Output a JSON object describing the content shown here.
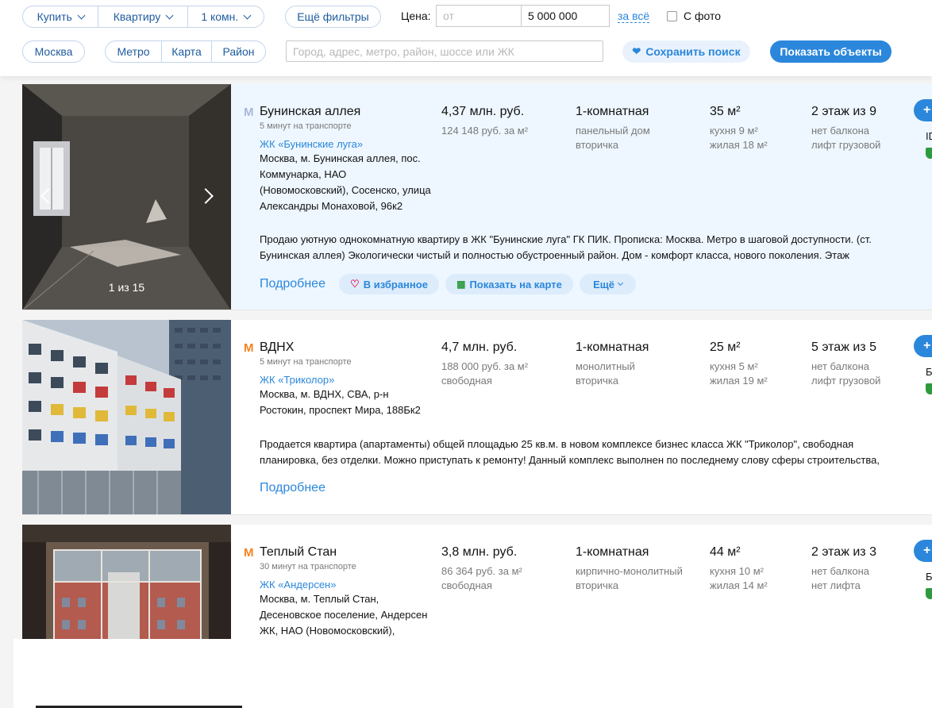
{
  "filters": {
    "deal": "Купить",
    "type": "Квартиру",
    "rooms": "1 комн.",
    "more_filters": "Ещё фильтры",
    "price_label": "Цена:",
    "price_from_placeholder": "от",
    "price_to": "5 000 000",
    "price_unit": "за всё",
    "photo_label": "С фото",
    "city": "Москва",
    "metro": "Метро",
    "map": "Карта",
    "district": "Район",
    "search_placeholder": "Город, адрес, метро, район, шоссе или ЖК",
    "save_search": "Сохранить поиск",
    "show_objects": "Показать объекты"
  },
  "colors": {
    "accent": "#2b87db",
    "metro_line_1": "#a8b8d8",
    "metro_line_orange": "#f58220",
    "highlight_bg": "#eef7ff"
  },
  "listings": [
    {
      "station": "Бунинская аллея",
      "metro_icon": "metro-m-icon",
      "transport": "5 минут на транспорте",
      "complex": "ЖК «Бунинские луга»",
      "address": [
        "Москва, м. Бунинская аллея, пос.",
        "Коммунарка, НАО",
        "(Новомосковский), Сосенско, улица",
        "Александры Монаховой, 96к2"
      ],
      "price": "4,37 млн. руб.",
      "price_per_m": "124 148 руб. за м²",
      "price_note": "",
      "rooms": "1-комнатная",
      "building": "панельный дом",
      "market": "вторичка",
      "area": "35 м²",
      "kitchen": "кухня 9 м²",
      "living": "жилая 18 м²",
      "floor": "2 этаж из 9",
      "balcony": "нет балкона",
      "lift": "лифт грузовой",
      "desc": [
        "Продаю уютную однокомнатную квартиру в ЖК \"Бунинские луга\" ГК ПИК. Прописка: Москва. Метро в шаговой доступности. (ст.",
        "Бунинская аллея) Экологически чистый и полностью обустроенный район. Дом - комфорт класса, нового поколения. Этаж"
      ],
      "photo_counter": "1 из 15",
      "more": "Подробнее",
      "favorite": "В избранное",
      "show_map": "Показать на карте",
      "extra": "Ещё",
      "right_code": "ID"
    },
    {
      "station": "ВДНХ",
      "metro_icon": "metro-m-icon",
      "transport": "5 минут на транспорте",
      "complex": "ЖК «Триколор»",
      "address": [
        "Москва, м. ВДНХ, СВА, р-н",
        "Ростокин, проспект Мира, 188Бк2"
      ],
      "price": "4,7 млн. руб.",
      "price_per_m": "188 000 руб. за м²",
      "price_note": "свободная",
      "rooms": "1-комнатная",
      "building": "монолитный",
      "market": "вторичка",
      "area": "25 м²",
      "kitchen": "кухня 5 м²",
      "living": "жилая 19 м²",
      "floor": "5 этаж из 5",
      "balcony": "нет балкона",
      "lift": "лифт грузовой",
      "desc": [
        "Продается квартира (апартаменты) общей площадью 25 кв.м. в новом комплексе бизнес класса ЖК \"Триколор\", свободная",
        "планировка, без отделки. Можно приступать к ремонту! Данный комплекс выполнен по последнему слову сферы строительства,"
      ],
      "more": "Подробнее",
      "right_code": "Б"
    },
    {
      "station": "Теплый Стан",
      "metro_icon": "metro-m-icon",
      "transport": "30 минут на транспорте",
      "complex": "ЖК «Андерсен»",
      "address": [
        "Москва, м. Теплый Стан,",
        "Десеновское поселение, Андерсен",
        "ЖК, НАО (Новомосковский),"
      ],
      "price": "3,8 млн. руб.",
      "price_per_m": "86 364 руб. за м²",
      "price_note": "свободная",
      "rooms": "1-комнатная",
      "building": "кирпично-монолитный",
      "market": "вторичка",
      "area": "44 м²",
      "kitchen": "кухня 10 м²",
      "living": "жилая 14 м²",
      "floor": "2 этаж из 3",
      "balcony": "нет балкона",
      "lift": "нет лифта",
      "right_code": "Б"
    }
  ]
}
